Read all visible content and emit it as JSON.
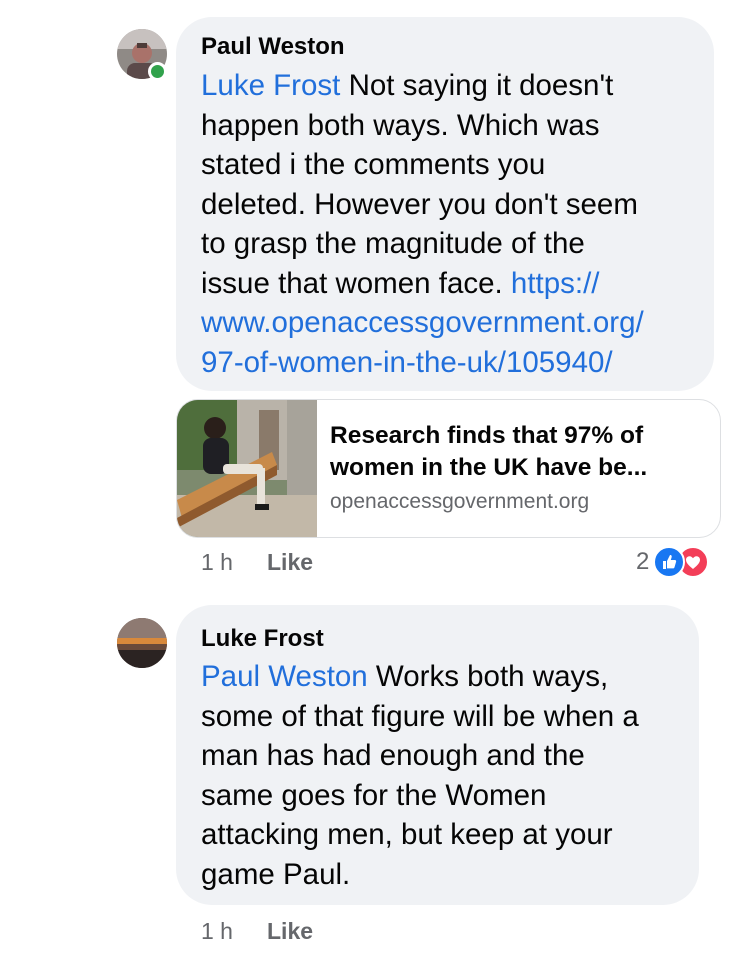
{
  "comments": [
    {
      "author": "Paul Weston",
      "mention": "Luke Frost",
      "text": " Not saying it doesn't\nhappen both ways. Which was\nstated i the comments you\ndeleted. However you don't seem\nto grasp the magnitude of the\nissue that women face.  ",
      "link_text": "https://\nwww.openaccessgovernment.org/\n97-of-women-in-the-uk/105940/",
      "link_preview": {
        "title": "Research finds that 97% of\nwomen in the UK have be...",
        "domain": "openaccessgovernment.org"
      },
      "time": "1 h",
      "like_label": "Like",
      "reaction_count": "2",
      "reactions": [
        "like-icon",
        "love-icon"
      ],
      "online": true
    },
    {
      "author": "Luke Frost",
      "mention": "Paul Weston",
      "text": " Works both ways,\nsome of that figure will be when a\nman has had enough and the\nsame goes for the Women\nattacking men, but keep at your\ngame Paul.",
      "time": "1 h",
      "like_label": "Like"
    }
  ],
  "colors": {
    "bubble": "#f0f2f5",
    "mention": "#216fdb",
    "meta": "#65676b",
    "online": "#31a24c",
    "like": "#1877f2",
    "love": "#f33e58"
  }
}
